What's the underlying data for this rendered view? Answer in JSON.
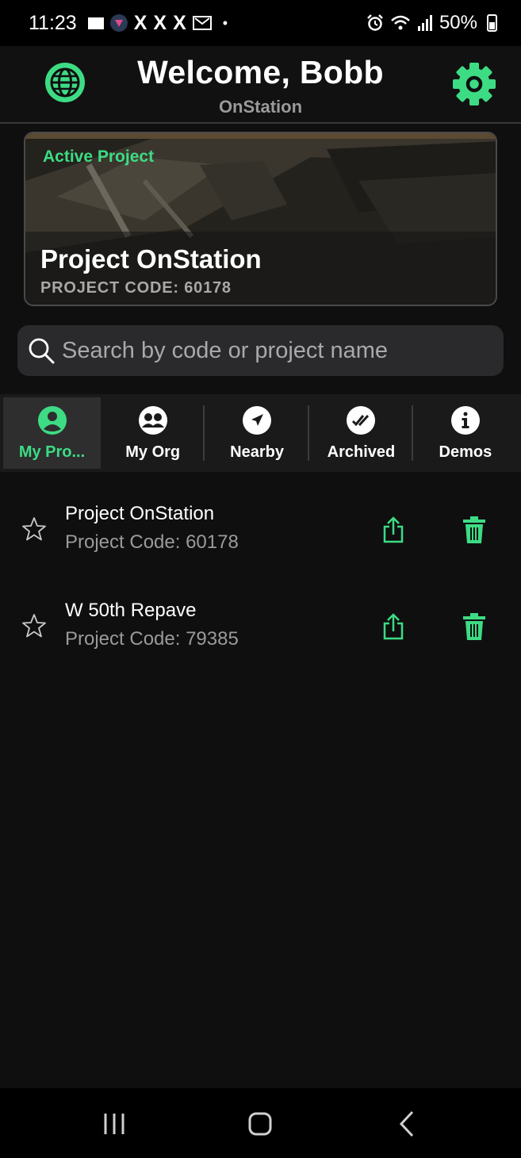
{
  "status_bar": {
    "time": "11:23",
    "x_glyphs": [
      "X",
      "X",
      "X"
    ],
    "dot": "•",
    "battery": "50%"
  },
  "header": {
    "title": "Welcome, Bobb",
    "subtitle": "OnStation",
    "left_icon": "globe-icon",
    "right_icon": "gear-icon"
  },
  "active_project": {
    "label": "Active Project",
    "name": "Project OnStation",
    "code": "PROJECT CODE: 60178"
  },
  "search": {
    "placeholder": "Search by code or project name",
    "value": ""
  },
  "tabs": [
    {
      "label": "My Pro...",
      "icon": "person-icon",
      "active": true
    },
    {
      "label": "My Org",
      "icon": "group-icon",
      "active": false
    },
    {
      "label": "Nearby",
      "icon": "navigation-icon",
      "active": false
    },
    {
      "label": "Archived",
      "icon": "double-check-icon",
      "active": false
    },
    {
      "label": "Demos",
      "icon": "info-icon",
      "active": false
    }
  ],
  "projects": [
    {
      "name": "Project OnStation",
      "code": "Project Code: 60178"
    },
    {
      "name": "W 50th Repave",
      "code": "Project Code: 79385"
    }
  ],
  "colors": {
    "accent": "#3ddc84",
    "background": "#0f0f10",
    "card_border": "#4a4a4a",
    "muted_text": "#9a9a9a"
  }
}
